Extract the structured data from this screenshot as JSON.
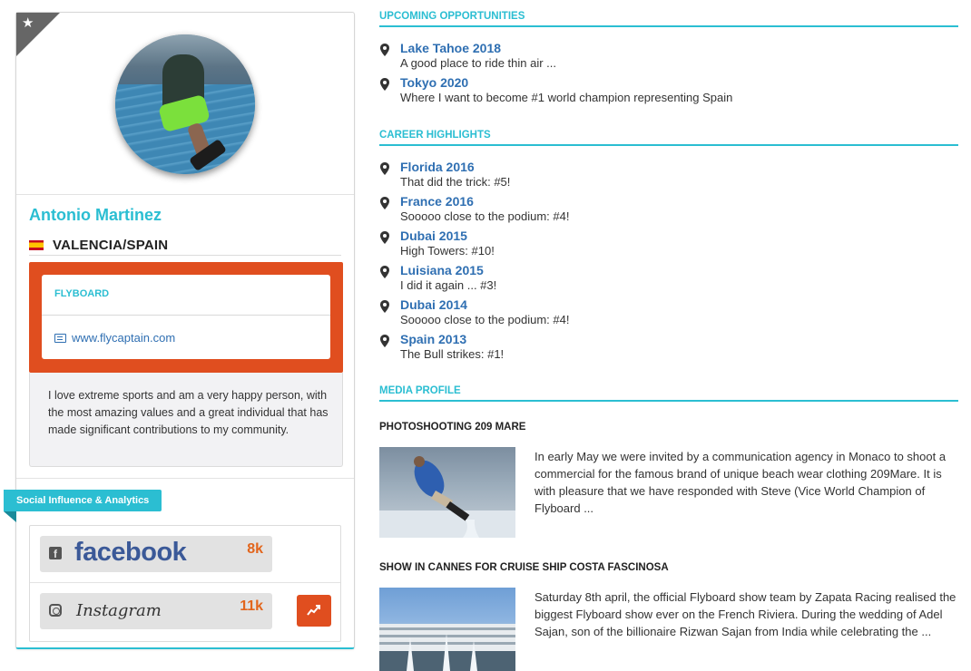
{
  "profile": {
    "name": "Antonio Martinez",
    "location": "VALENCIA/SPAIN",
    "sport": "FLYBOARD",
    "website": "www.flycaptain.com",
    "bio": "I love extreme sports and am a very happy person, with the most amazing values and a great individual that has made significant contributions to my community.",
    "avatar_icon": "profile-photo",
    "corner_icon": "star-icon"
  },
  "social": {
    "ribbon_label": "Social Influence & Analytics",
    "facebook": {
      "label": "facebook",
      "count": "8k"
    },
    "instagram": {
      "label": "Instagram",
      "count": "11k"
    }
  },
  "upcoming": {
    "title": "UPCOMING OPPORTUNITIES",
    "items": [
      {
        "name": "Lake Tahoe 2018",
        "desc": "A good place to ride thin air ..."
      },
      {
        "name": "Tokyo 2020",
        "desc": "Where I want to become #1 world champion representing Spain"
      }
    ]
  },
  "career": {
    "title": "CAREER HIGHLIGHTS",
    "items": [
      {
        "name": "Florida 2016",
        "desc": "That did the trick: #5!"
      },
      {
        "name": "France 2016",
        "desc": "Sooooo close to the podium: #4!"
      },
      {
        "name": "Dubai 2015",
        "desc": "High Towers: #10!"
      },
      {
        "name": "Luisiana 2015",
        "desc": "I did it again ... #3!"
      },
      {
        "name": "Dubai 2014",
        "desc": "Sooooo close to the podium: #4!"
      },
      {
        "name": "Spain 2013",
        "desc": "The Bull strikes: #1!"
      }
    ]
  },
  "media": {
    "title": "MEDIA PROFILE",
    "items": [
      {
        "title": "PHOTOSHOOTING 209 MARE",
        "text": "In early May we were invited by a communication agency in Monaco to shoot a commercial for the famous brand of unique beach wear clothing 209Mare. It is with pleasure that we have responded with Steve (Vice World Champion of Flyboard ..."
      },
      {
        "title": "SHOW IN CANNES FOR CRUISE SHIP COSTA FASCINOSA",
        "text": "Saturday 8th april, the official Flyboard show team by Zapata Racing realised the biggest Flyboard show ever on the French Riviera. During the wedding of Adel Sajan, son of the billionaire Rizwan Sajan from India while celebrating the ..."
      }
    ]
  },
  "colors": {
    "accent": "#2bbed2",
    "link": "#2f6fb2",
    "orange": "#e04e1f",
    "count": "#e2651c",
    "facebook": "#3b5998"
  }
}
